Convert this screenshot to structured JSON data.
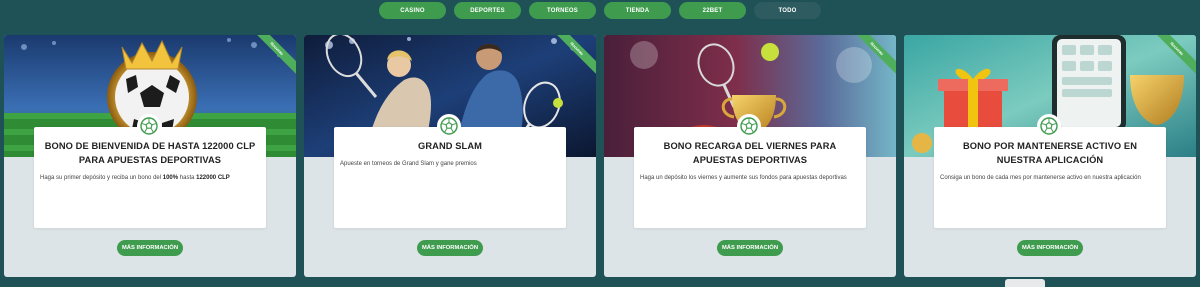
{
  "tabs": [
    {
      "label": "CASINO"
    },
    {
      "label": "DEPORTES"
    },
    {
      "label": "TORNEOS"
    },
    {
      "label": "TIENDA"
    },
    {
      "label": "22BET"
    },
    {
      "label": "TODO",
      "active": true
    }
  ],
  "cards": [
    {
      "ribbon": "Nouveau",
      "title": "BONO DE BIENVENIDA DE HASTA 122000 CLP PARA APUESTAS DEPORTIVAS",
      "desc_pre": "Haga su primer depósito y reciba un bono del ",
      "desc_b1": "100%",
      "desc_mid": " hasta ",
      "desc_b2": "122000 CLP",
      "button": "MÁS INFORMACIÓN",
      "image": "soccer-ball-crown"
    },
    {
      "ribbon": "Nouveau",
      "title": "GRAND SLAM",
      "desc": "Apueste en torneos de Grand Slam y gane premios",
      "button": "MÁS INFORMACIÓN",
      "image": "tennis-players"
    },
    {
      "ribbon": "Nouveau",
      "title": "BONO RECARGA DEL VIERNES PARA APUESTAS DEPORTIVAS",
      "desc": "Haga un depósito los viernes y aumente sus fondos para apuestas deportivas",
      "button": "MÁS INFORMACIÓN",
      "image": "tennis-trophy"
    },
    {
      "ribbon": "Nouveau",
      "title": "BONO POR MANTENERSE ACTIVO EN NUESTRA APLICACIÓN",
      "desc": "Consiga un bono de cada mes por mantenerse activo en nuestra aplicación",
      "button": "MÁS INFORMACIÓN",
      "image": "phone-gift-trophy"
    }
  ],
  "colors": {
    "page_bg": "#1f5257",
    "button_green": "#3f9c4f",
    "card_bg": "#dde4e7"
  }
}
